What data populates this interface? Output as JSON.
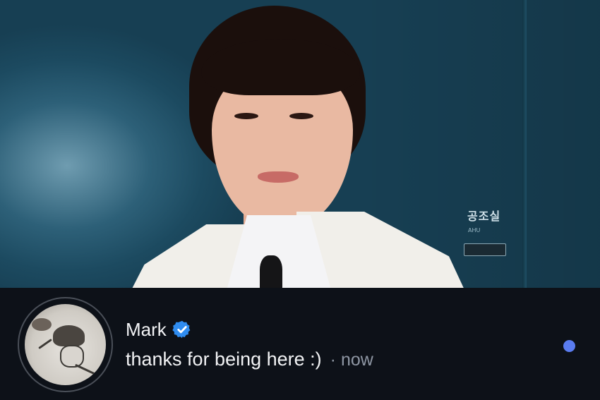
{
  "photo": {
    "wall_sign": "공조실",
    "wall_sign_sub": "AHU"
  },
  "notification": {
    "sender_name": "Mark",
    "verified_icon": "verified-badge-icon",
    "message": "thanks for being here :)",
    "separator": "·",
    "timestamp": "now",
    "unread_indicator": "unread-dot",
    "colors": {
      "background": "#0d1118",
      "verified": "#2f8cf0",
      "unread": "#5a7cf0",
      "meta_text": "#8e96a3"
    }
  }
}
